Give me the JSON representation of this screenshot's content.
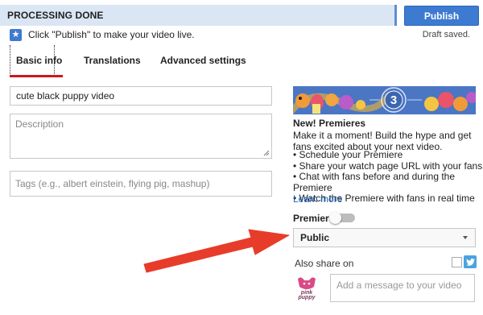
{
  "status": {
    "text": "PROCESSING DONE"
  },
  "publish": {
    "label": "Publish"
  },
  "hint": {
    "text": "Click \"Publish\" to make your video live."
  },
  "draft_status": "Draft saved.",
  "tabs": [
    {
      "label": "Basic info",
      "active": true
    },
    {
      "label": "Translations",
      "active": false
    },
    {
      "label": "Advanced settings",
      "active": false
    }
  ],
  "form": {
    "title_value": "cute black puppy video",
    "description_placeholder": "Description",
    "tags_placeholder": "Tags (e.g., albert einstein, flying pig, mashup)"
  },
  "premieres": {
    "banner_number": "3",
    "title": "New! Premieres",
    "description": "Make it a moment! Build the hype and get fans excited about your next video.",
    "features": [
      "Schedule your Premiere",
      "Share your watch page URL with your fans",
      "Chat with fans before and during the Premiere",
      "Watch the Premiere with fans in real time"
    ],
    "learn_more": "Learn more"
  },
  "premiere_toggle": {
    "label": "Premiere",
    "enabled": false
  },
  "privacy": {
    "selected": "Public"
  },
  "share": {
    "label": "Also share on",
    "message_placeholder": "Add a message to your video",
    "avatar_text": "pink puppy"
  },
  "colors": {
    "status_bg": "#dbe6f4",
    "publish_bg": "#3d7ad1",
    "tab_underline": "#cc181e",
    "link": "#1d64c4",
    "annotation_arrow": "#e83c2a",
    "twitter": "#4aa3df"
  },
  "icons": [
    "star-icon",
    "resize-grip-icon",
    "dropdown-arrow-icon",
    "twitter-icon"
  ]
}
